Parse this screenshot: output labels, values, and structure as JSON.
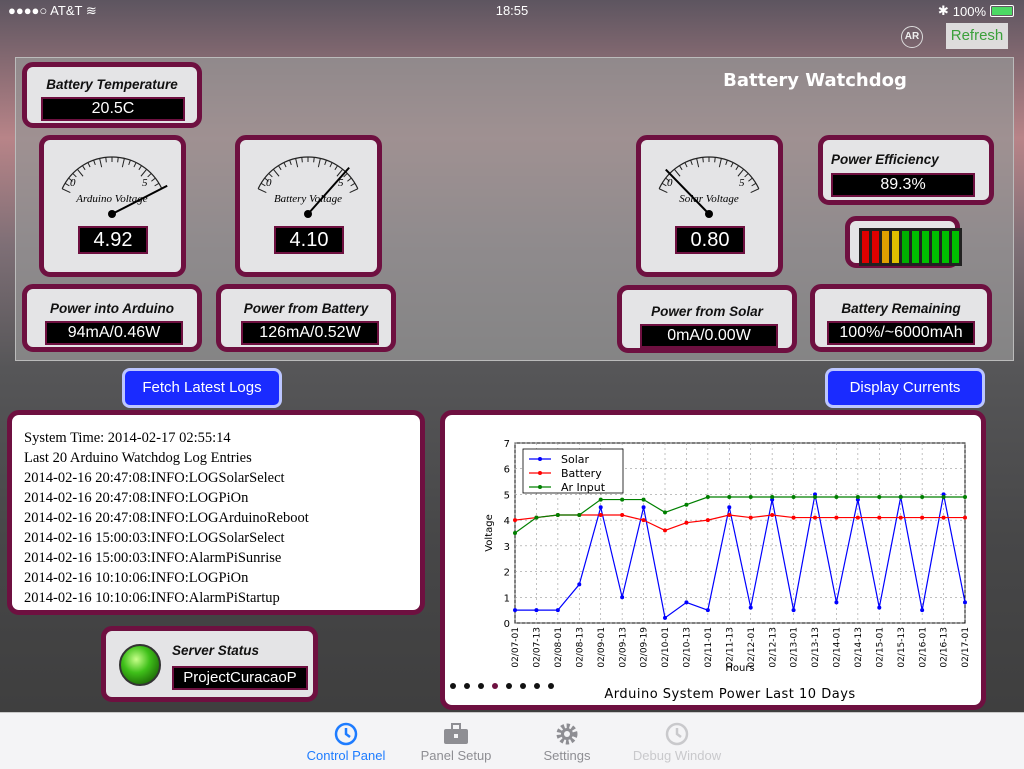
{
  "status_bar": {
    "carrier": "AT&T",
    "time": "18:55",
    "battery": "100%"
  },
  "toolbar": {
    "ar_label": "AR",
    "refresh_label": "Refresh"
  },
  "app_title": "Battery Watchdog",
  "battery_temperature": {
    "label": "Battery Temperature",
    "value": "20.5C"
  },
  "gauges": [
    {
      "label": "Arduino Voltage",
      "scale_min": "0",
      "scale_max": "5",
      "value": "4.92",
      "reading": 4.92
    },
    {
      "label": "Battery Voltage",
      "scale_min": "0",
      "scale_max": "5",
      "value": "4.10",
      "reading": 4.1
    },
    {
      "label": "Solar Voltage",
      "scale_min": "0",
      "scale_max": "5",
      "value": "0.80",
      "reading": 0.8
    }
  ],
  "power_efficiency": {
    "label": "Power Efficiency",
    "value": "89.3%"
  },
  "battery_meter": {
    "segments": [
      "#e00000",
      "#e00000",
      "#e0a000",
      "#e0c000",
      "#00b000",
      "#00c000",
      "#00c000",
      "#00c000",
      "#00c000",
      "#00c000"
    ]
  },
  "power_into_arduino": {
    "label": "Power into Arduino",
    "value": "94mA/0.46W"
  },
  "power_from_battery": {
    "label": "Power from Battery",
    "value": "126mA/0.52W"
  },
  "power_from_solar": {
    "label": "Power from Solar",
    "value": "0mA/0.00W"
  },
  "battery_remaining": {
    "label": "Battery Remaining",
    "value": "100%/~6000mAh"
  },
  "buttons": {
    "fetch_logs": "Fetch Latest Logs",
    "display_currents": "Display Currents"
  },
  "log": {
    "lines": [
      "System Time: 2014-02-17 02:55:14",
      "Last 20 Arduino Watchdog Log Entries",
      "2014-02-16 20:47:08:INFO:LOGSolarSelect",
      "2014-02-16 20:47:08:INFO:LOGPiOn",
      "2014-02-16 20:47:08:INFO:LOGArduinoReboot",
      "2014-02-16 15:00:03:INFO:LOGSolarSelect",
      "2014-02-16 15:00:03:INFO:AlarmPiSunrise",
      "2014-02-16 10:10:06:INFO:LOGPiOn",
      "2014-02-16 10:10:06:INFO:AlarmPiStartup"
    ]
  },
  "server_status": {
    "label": "Server Status",
    "value": "ProjectCuracaoP"
  },
  "page_dots": {
    "count": 8,
    "active": 3,
    "colors": {
      "normal": "#111111",
      "active": "#6e1040"
    }
  },
  "chart_data": {
    "type": "line",
    "title": "Arduino System Power Last 10 Days",
    "xlabel": "Hours",
    "ylabel": "Voltage",
    "ylim": [
      0,
      7
    ],
    "yticks": [
      "0",
      "1",
      "2",
      "3",
      "4",
      "5",
      "6",
      "7"
    ],
    "grid": true,
    "legend_position": "top-left",
    "x": [
      "02/07-01",
      "02/07-13",
      "02/08-01",
      "02/08-13",
      "02/09-01",
      "02/09-13",
      "02/09-19",
      "02/10-01",
      "02/10-13",
      "02/11-01",
      "02/11-13",
      "02/12-01",
      "02/12-13",
      "02/13-01",
      "02/13-13",
      "02/14-01",
      "02/14-13",
      "02/15-01",
      "02/15-13",
      "02/16-01",
      "02/16-13",
      "02/17-01"
    ],
    "series": [
      {
        "name": "Solar",
        "color": "#0000ff",
        "values": [
          0.5,
          0.5,
          0.5,
          1.5,
          4.5,
          1.0,
          4.5,
          0.2,
          0.8,
          0.5,
          4.5,
          0.6,
          4.8,
          0.5,
          5.0,
          0.8,
          4.8,
          0.6,
          4.9,
          0.5,
          5.0,
          0.8
        ]
      },
      {
        "name": "Battery",
        "color": "#ff0000",
        "values": [
          4.0,
          4.1,
          4.2,
          4.2,
          4.2,
          4.2,
          4.0,
          3.6,
          3.9,
          4.0,
          4.2,
          4.1,
          4.2,
          4.1,
          4.1,
          4.1,
          4.1,
          4.1,
          4.1,
          4.1,
          4.1,
          4.1
        ]
      },
      {
        "name": "Ar Input",
        "color": "#008000",
        "values": [
          3.5,
          4.1,
          4.2,
          4.2,
          4.8,
          4.8,
          4.8,
          4.3,
          4.6,
          4.9,
          4.9,
          4.9,
          4.9,
          4.9,
          4.9,
          4.9,
          4.9,
          4.9,
          4.9,
          4.9,
          4.9,
          4.9
        ]
      }
    ]
  },
  "tabs": [
    {
      "label": "Control Panel",
      "icon": "clock-icon",
      "state": "active"
    },
    {
      "label": "Panel Setup",
      "icon": "toolbox-icon",
      "state": "normal"
    },
    {
      "label": "Settings",
      "icon": "gear-icon",
      "state": "normal"
    },
    {
      "label": "Debug Window",
      "icon": "clock-icon",
      "state": "disabled"
    }
  ],
  "colors": {
    "accent": "#1e7cff",
    "card_border": "#6e1040",
    "button_blue": "#1a2bff"
  }
}
